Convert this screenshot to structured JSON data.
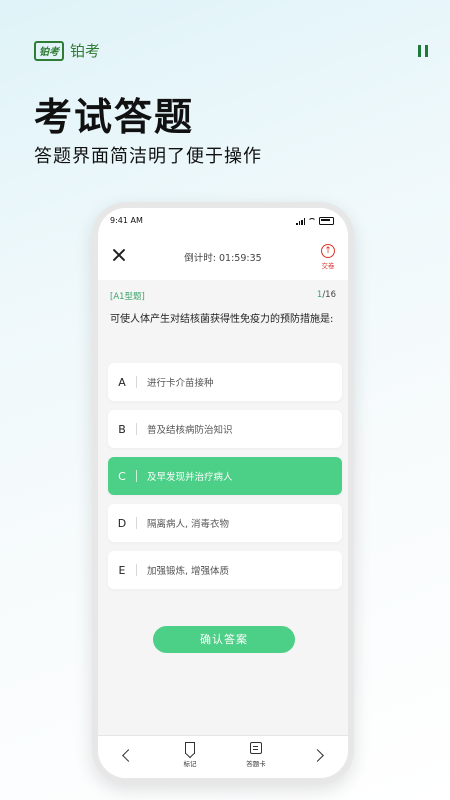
{
  "brand": {
    "logo_text": "铂考",
    "name": "铂考"
  },
  "hero": {
    "title": "考试答题",
    "subtitle": "答题界面简洁明了便于操作"
  },
  "status_bar": {
    "time": "9:41 AM"
  },
  "exam": {
    "countdown": "倒计时:  01:59:35",
    "submit_label": "交卷",
    "submit_icon": "arrow-up-icon",
    "question_type": "[A1型题]",
    "current": "1",
    "total": "/16",
    "question": "可使人体产生对结核菌获得性免疫力的预防措施是:",
    "options": [
      {
        "letter": "A",
        "text": "进行卡介苗接种",
        "selected": false
      },
      {
        "letter": "B",
        "text": "普及结核病防治知识",
        "selected": false
      },
      {
        "letter": "C",
        "text": "及早发现并治疗病人",
        "selected": true
      },
      {
        "letter": "D",
        "text": "隔离病人, 消毒衣物",
        "selected": false
      },
      {
        "letter": "E",
        "text": "加强锻炼, 增强体质",
        "selected": false
      }
    ],
    "confirm_label": "确认答案"
  },
  "bottom_bar": {
    "bookmark_label": "标记",
    "card_label": "答题卡"
  },
  "colors": {
    "accent": "#4ccf86",
    "brand": "#2f7d35",
    "submit": "#d9352b"
  }
}
